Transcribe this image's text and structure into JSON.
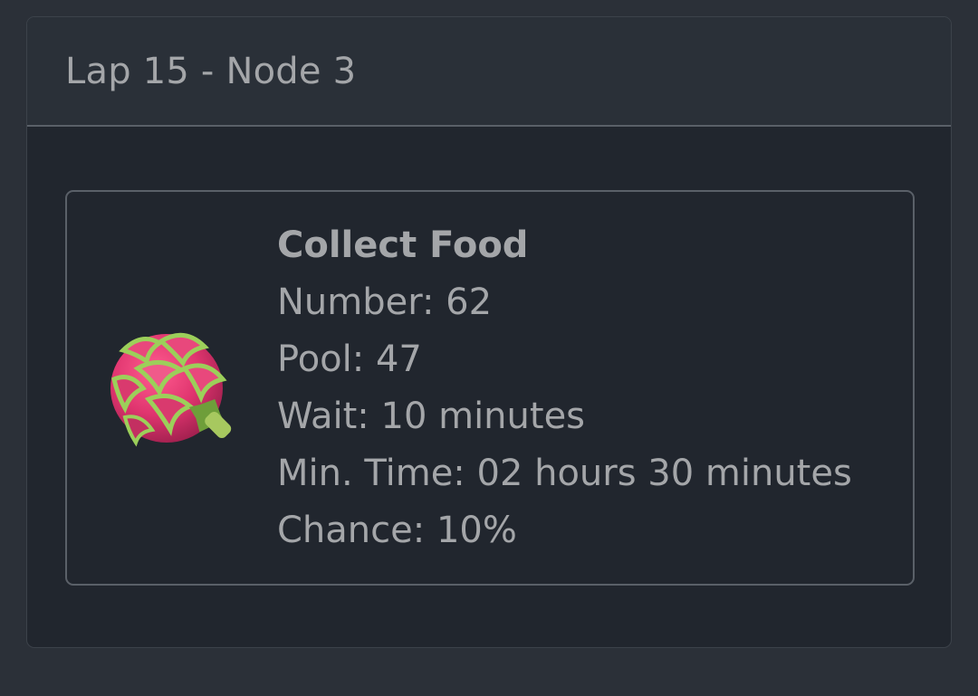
{
  "header": {
    "title": "Lap 15 - Node 3"
  },
  "task": {
    "icon": "dragon-fruit-icon",
    "name": "Collect Food",
    "number": "Number: 62",
    "pool": "Pool: 47",
    "wait": "Wait: 10 minutes",
    "min_time": "Min. Time: 02 hours 30 minutes",
    "chance": "Chance: 10%"
  },
  "colors": {
    "page_bg": "#2b3038",
    "card_bg": "#21262e",
    "header_bg": "#2a3038",
    "border": "#5a6068",
    "text": "#a4a6a9",
    "fruit_pink": "#e0356f",
    "fruit_green": "#9ccf5a"
  }
}
